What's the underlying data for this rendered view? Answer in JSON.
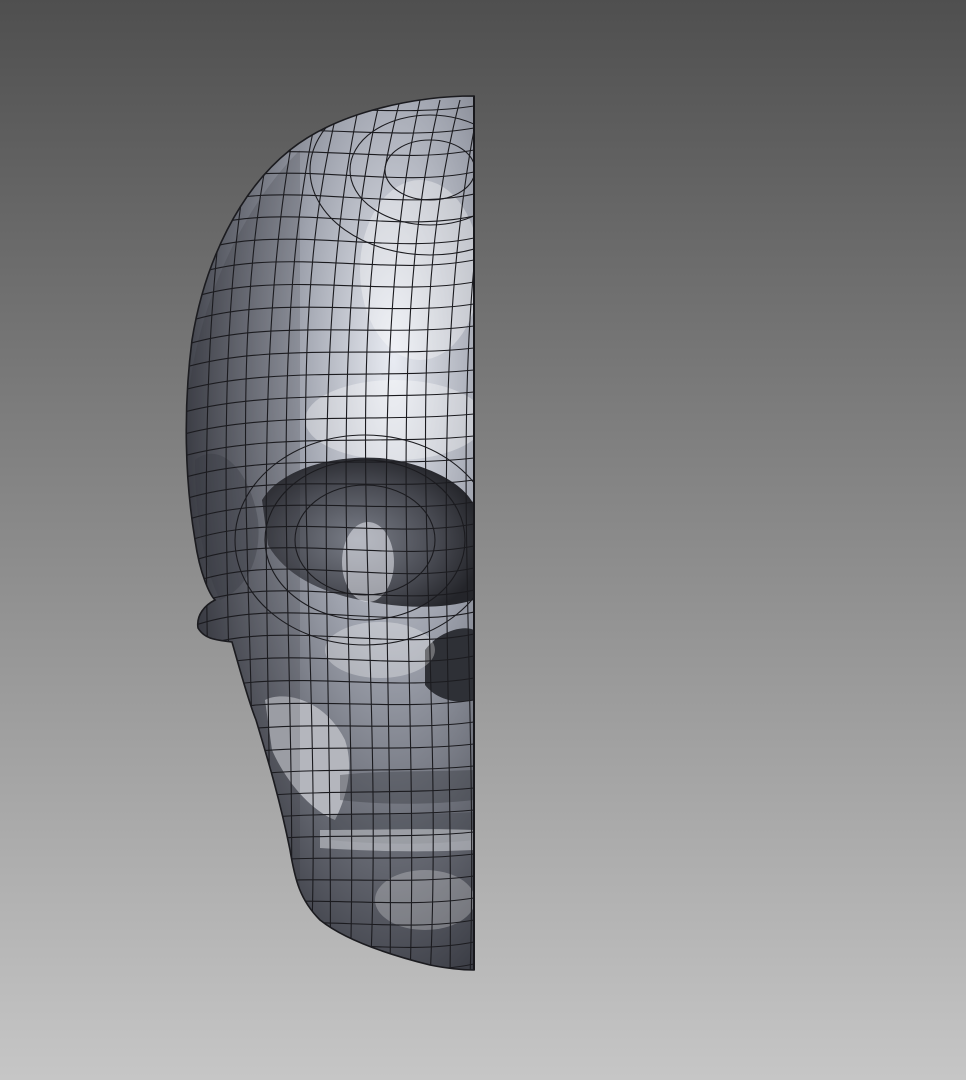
{
  "viewport": {
    "background_top": "#4f4f4f",
    "background_bottom": "#c6c6c6",
    "model_name": "half-skull-surface-model",
    "model_color_light": "#e9ecf3",
    "model_color_mid": "#9ea2ad",
    "model_color_dark": "#3a3c44",
    "wireframe_color": "#1b1b1f",
    "section_edge_color": "#111114",
    "display_mode": "shaded-with-edges"
  }
}
